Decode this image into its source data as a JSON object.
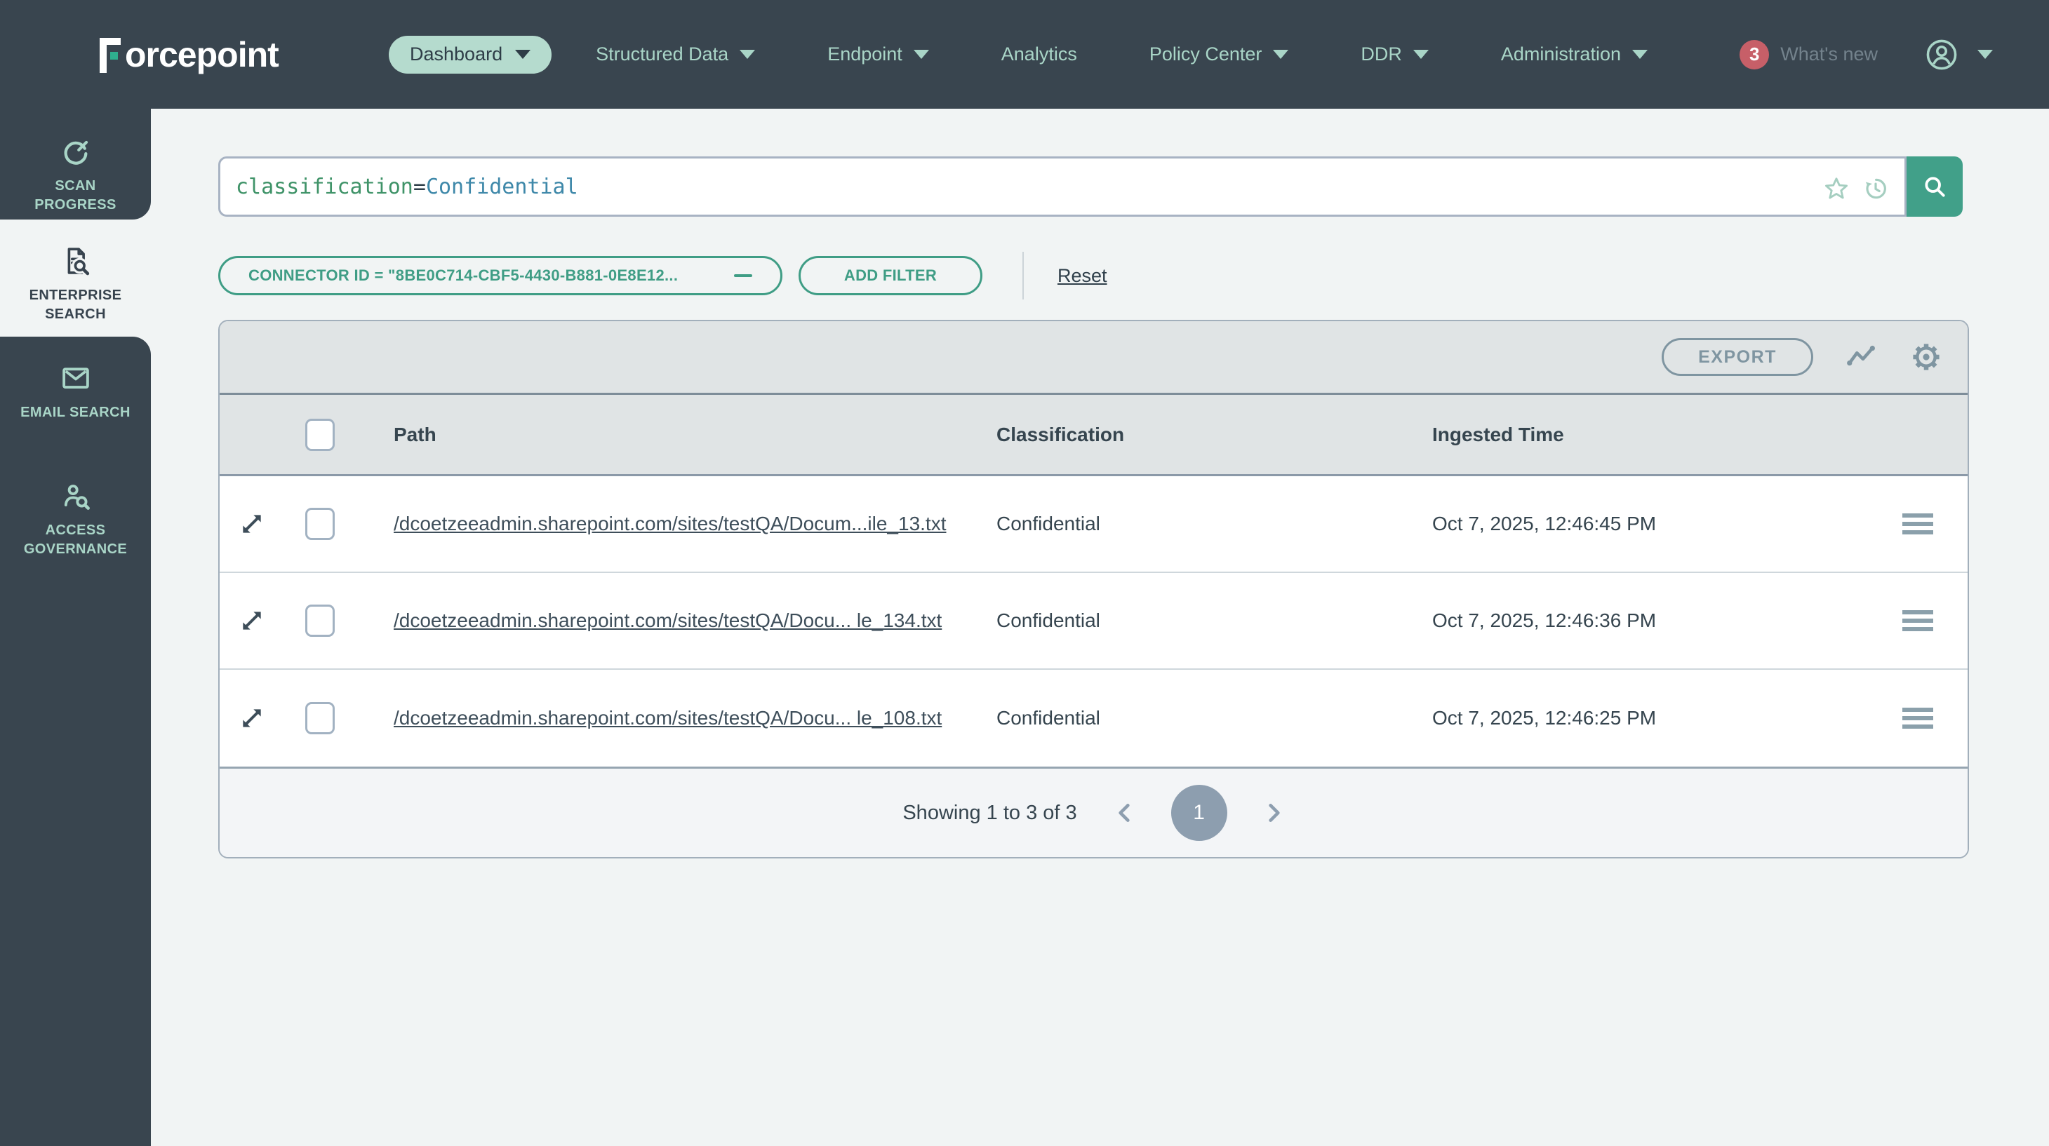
{
  "nav": {
    "brand": "Forcepoint",
    "items": [
      {
        "label": "Dashboard",
        "caret": true,
        "active": true
      },
      {
        "label": "Structured Data",
        "caret": true
      },
      {
        "label": "Endpoint",
        "caret": true
      },
      {
        "label": "Analytics",
        "caret": false
      },
      {
        "label": "Policy Center",
        "caret": true
      },
      {
        "label": "DDR",
        "caret": true
      },
      {
        "label": "Administration",
        "caret": true
      }
    ],
    "whats_new_badge": "3",
    "whats_new_label": "What's new"
  },
  "sidebar": {
    "items": [
      {
        "label": "SCAN PROGRESS",
        "icon": "scan-progress-icon",
        "active": false
      },
      {
        "label": "ENTERPRISE SEARCH",
        "icon": "enterprise-search-icon",
        "active": true
      },
      {
        "label": "EMAIL SEARCH",
        "icon": "email-search-icon",
        "active": false
      },
      {
        "label": "ACCESS GOVERNANCE",
        "icon": "access-governance-icon",
        "active": false
      }
    ]
  },
  "search": {
    "query": {
      "field": "classification",
      "operator": "=",
      "value": "Confidential"
    }
  },
  "filters": {
    "chips": [
      {
        "label": "CONNECTOR ID = \"8BE0C714-CBF5-4430-B881-0E8E12..."
      }
    ],
    "add_filter_label": "ADD FILTER",
    "reset_label": "Reset"
  },
  "table": {
    "export_label": "EXPORT",
    "columns": [
      "Path",
      "Classification",
      "Ingested Time"
    ],
    "rows": [
      {
        "path": "/dcoetzeeadmin.sharepoint.com/sites/testQA/Docum...ile_13.txt",
        "classification": "Confidential",
        "ingested_time": "Oct 7, 2025, 12:46:45 PM"
      },
      {
        "path": "/dcoetzeeadmin.sharepoint.com/sites/testQA/Docu... le_134.txt",
        "classification": "Confidential",
        "ingested_time": "Oct 7, 2025, 12:46:36 PM"
      },
      {
        "path": "/dcoetzeeadmin.sharepoint.com/sites/testQA/Docu... le_108.txt",
        "classification": "Confidential",
        "ingested_time": "Oct 7, 2025, 12:46:25 PM"
      }
    ],
    "pagination": {
      "summary": "Showing 1 to 3 of 3",
      "current_page": "1"
    }
  },
  "colors": {
    "nav_dark": "#39454f",
    "mint": "#a9d5c7",
    "pill_bg": "#b5dbce",
    "accent_teal": "#41a089",
    "chip_teal": "#3f9d85",
    "badge_red": "#c75f68",
    "query_field_green": "#3f9368",
    "query_value_blue": "#3e88a9",
    "page_bg": "#f1f4f4"
  }
}
